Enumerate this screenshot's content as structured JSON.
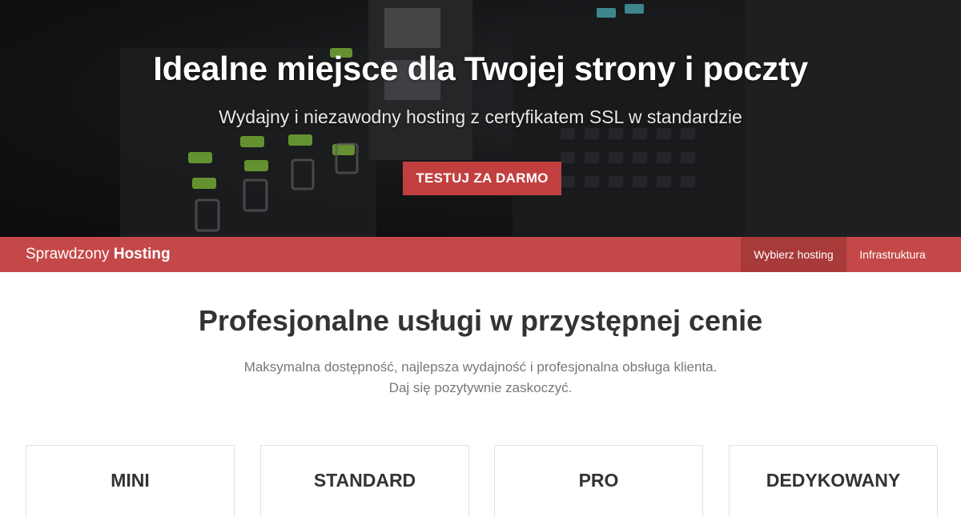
{
  "hero": {
    "title": "Idealne miejsce dla Twojej strony i poczty",
    "subtitle": "Wydajny i niezawodny hosting z certyfikatem SSL w standardzie",
    "cta_label": "TESTUJ ZA DARMO",
    "background_image": "server-rack-photo"
  },
  "navbar": {
    "brand_light": "Sprawdzony",
    "brand_bold": "Hosting",
    "items": [
      {
        "label": "Wybierz hosting",
        "active": true
      },
      {
        "label": "Infrastruktura",
        "active": false
      }
    ]
  },
  "main": {
    "title": "Profesjonalne usługi w przystępnej cenie",
    "description_line1": "Maksymalna dostępność, najlepsza wydajność i profesjonalna obsługa klienta.",
    "description_line2": "Daj się pozytywnie zaskoczyć.",
    "plans": [
      {
        "name": "MINI"
      },
      {
        "name": "STANDARD"
      },
      {
        "name": "PRO"
      },
      {
        "name": "DEDYKOWANY"
      }
    ]
  },
  "colors": {
    "accent": "#c54848",
    "accent_dark": "#a83a3a",
    "cta": "#c1403f",
    "heading": "#333333",
    "muted": "#777777"
  }
}
